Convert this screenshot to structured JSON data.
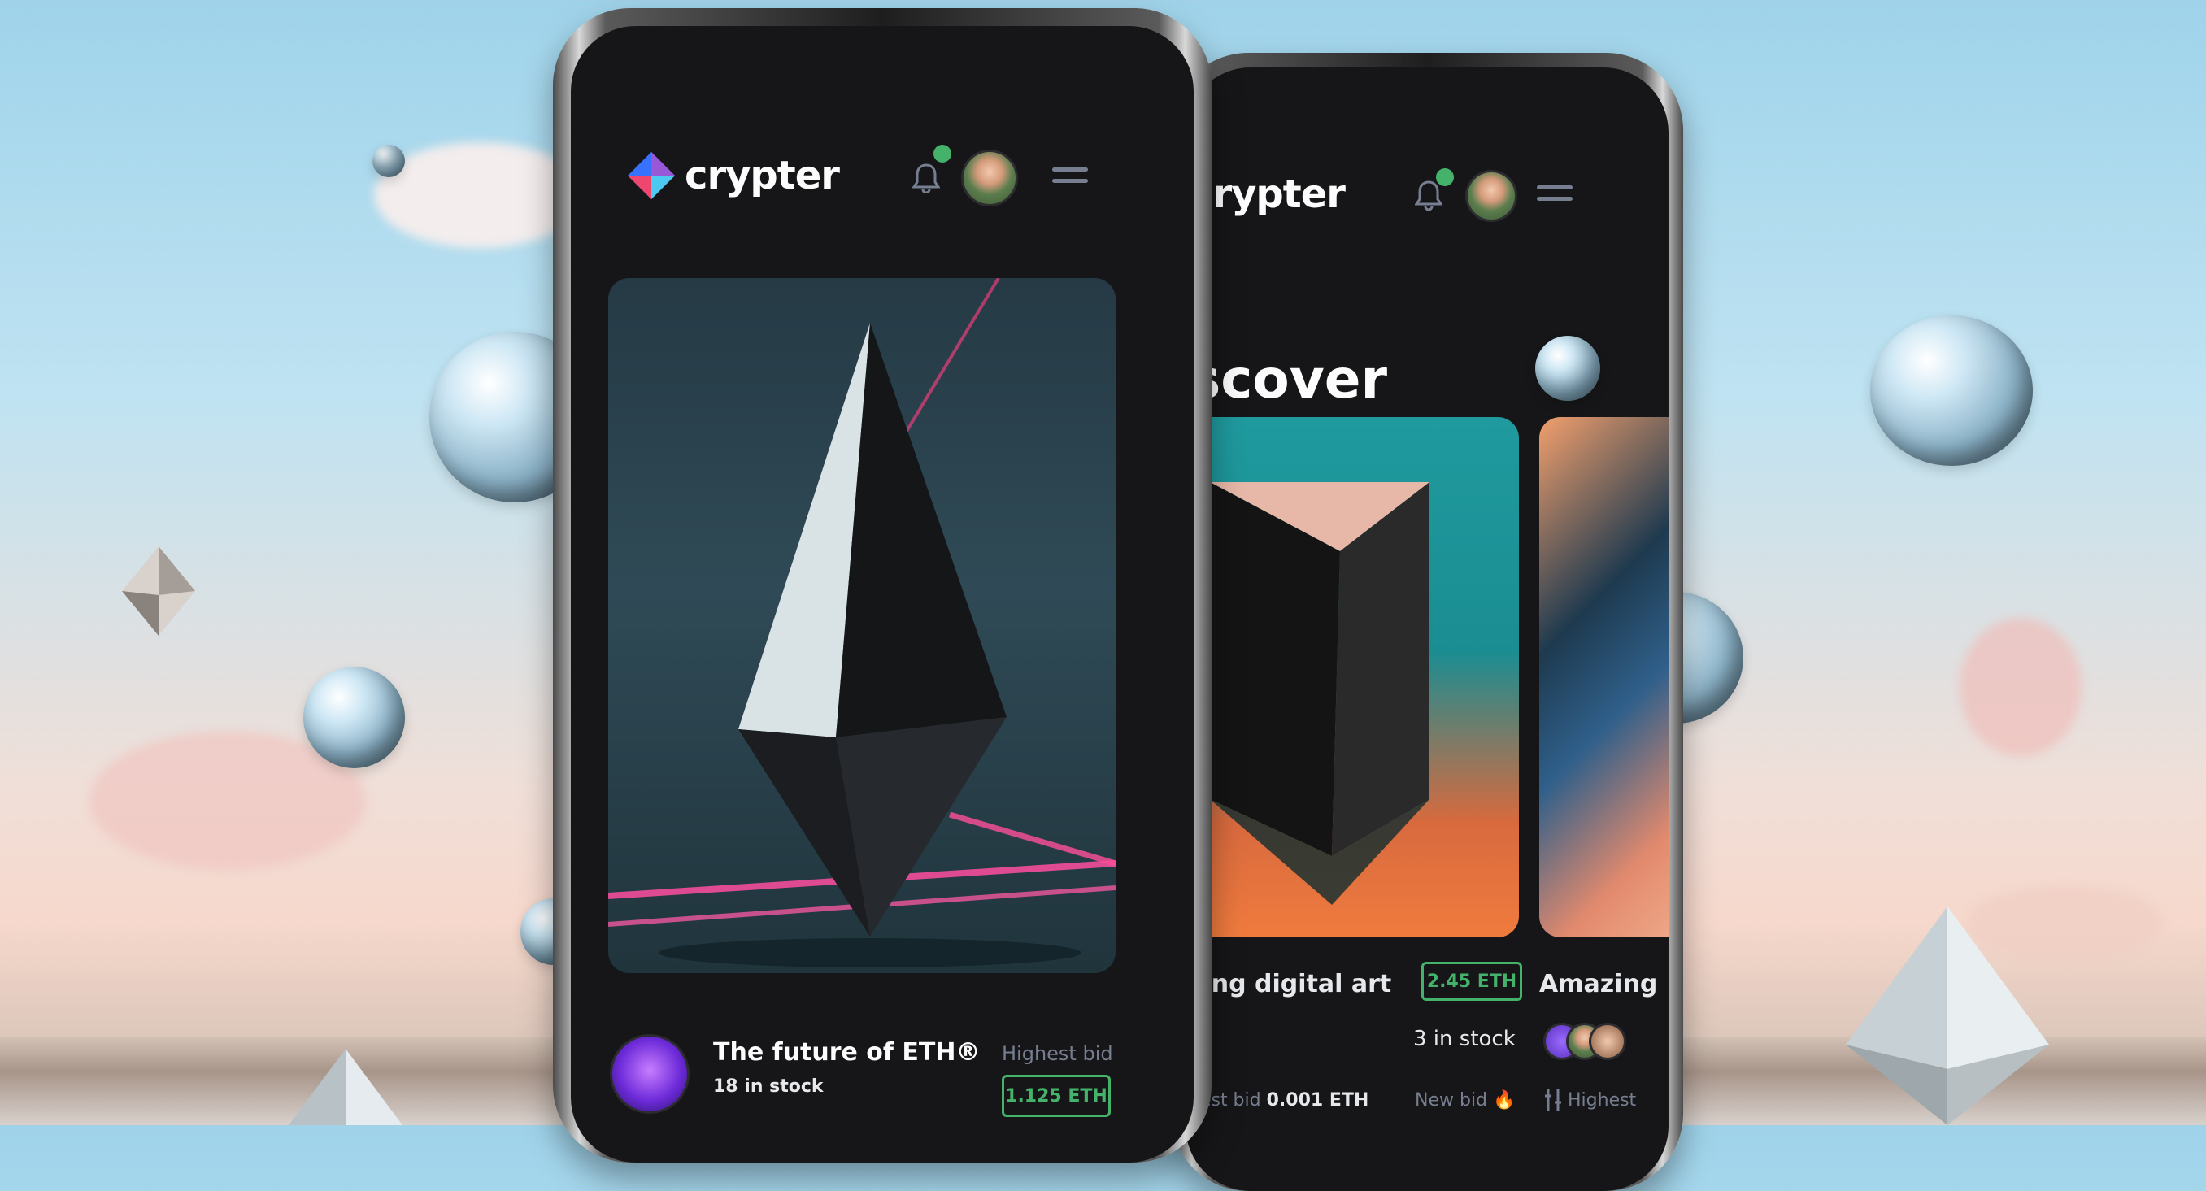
{
  "brand": {
    "name": "crypter",
    "accent": "#45b26b",
    "background": "#161618"
  },
  "front_phone": {
    "logo_text": "crypter",
    "item": {
      "title": "The future of ETH®",
      "stock": "18 in stock",
      "bid_label": "Highest bid",
      "price": "1.125 ETH"
    }
  },
  "back_phone": {
    "logo_text": "crypter",
    "heading": "scover",
    "card1": {
      "title": "zing digital art",
      "price": "2.45 ETH",
      "stock": "3 in stock",
      "bid_label": "hest bid",
      "bid_value": "0.001 ETH",
      "new_bid": "New bid 🔥"
    },
    "card2": {
      "title": "Amazing",
      "bid_label": "Highest"
    }
  },
  "icons": [
    "diamond-logo-icon",
    "bell-icon",
    "notification-dot",
    "avatar",
    "menu-icon",
    "bid-icon"
  ]
}
